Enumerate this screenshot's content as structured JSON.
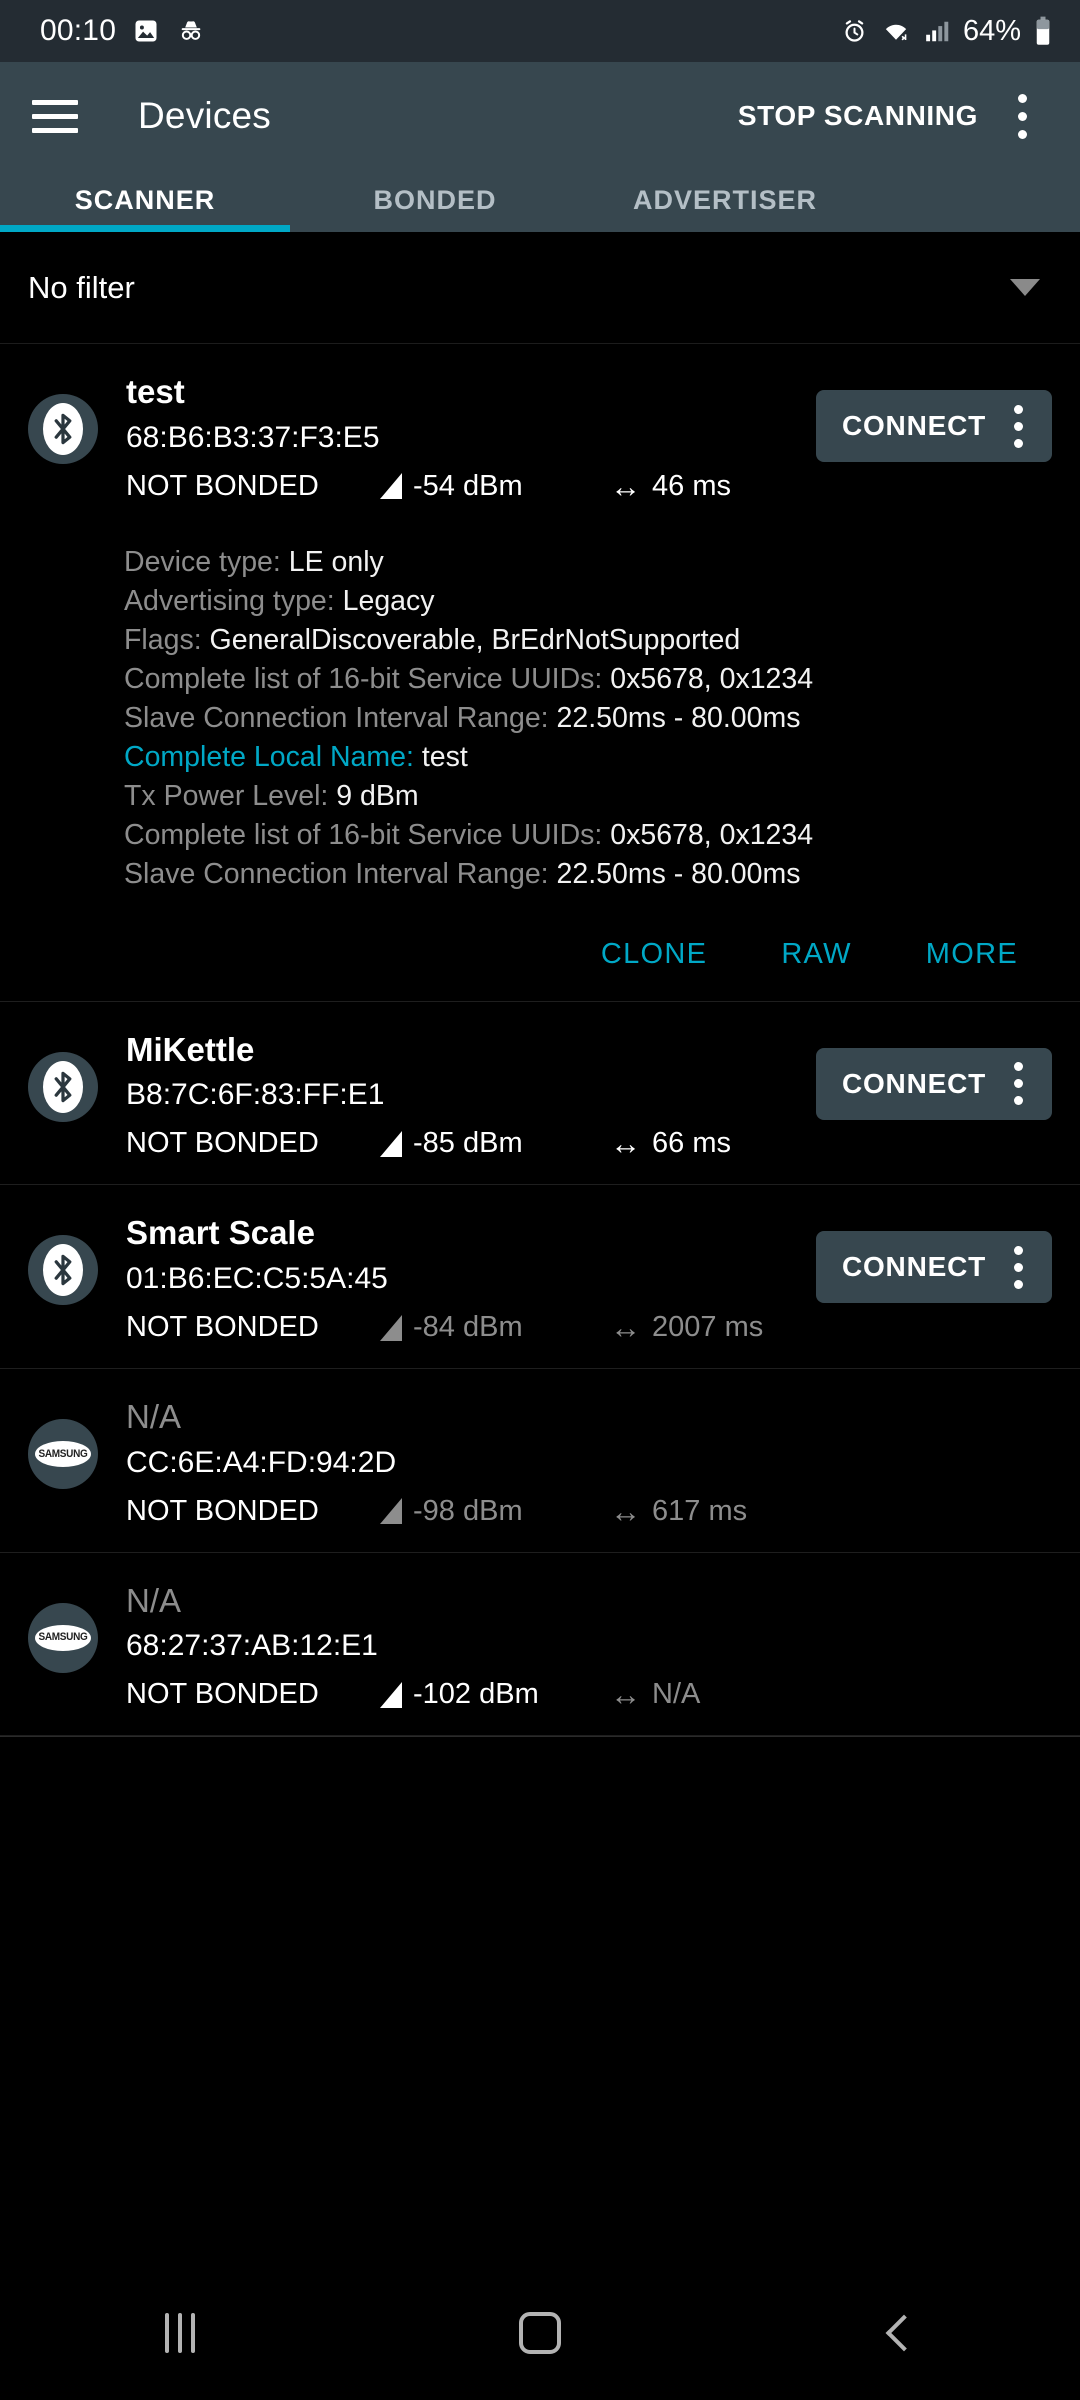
{
  "statusbar": {
    "time": "00:10",
    "battery": "64%",
    "icons": [
      "image-icon",
      "incognito-icon",
      "alarm-icon",
      "wifi-icon",
      "cellular-signal-icon",
      "battery-icon"
    ]
  },
  "appbar": {
    "title": "Devices",
    "action": "STOP SCANNING",
    "menu_icon": "overflow-menu-icon",
    "nav_icon": "hamburger-menu-icon"
  },
  "tabs": [
    {
      "label": "SCANNER",
      "active": true
    },
    {
      "label": "BONDED",
      "active": false
    },
    {
      "label": "ADVERTISER",
      "active": false
    }
  ],
  "filter": {
    "label": "No filter",
    "caret_icon": "chevron-down-icon"
  },
  "colors": {
    "accent": "#00a8c6",
    "appbar": "#37474f",
    "background": "#000000",
    "dim_text": "#8d8d8d"
  },
  "devices": [
    {
      "name": "test",
      "name_dim": false,
      "address": "68:B6:B3:37:F3:E5",
      "bond_state": "NOT BONDED",
      "rssi": "-54 dBm",
      "rssi_dim": false,
      "interval": "46 ms",
      "interval_dim": false,
      "avatar": "bluetooth-icon",
      "connect_label": "CONNECT",
      "has_connect": true,
      "expanded": true,
      "details": [
        {
          "key": "Device type:",
          "value": "LE only",
          "highlight": false
        },
        {
          "key": "Advertising type:",
          "value": "Legacy",
          "highlight": false
        },
        {
          "key": "Flags:",
          "value": "GeneralDiscoverable, BrEdrNotSupported",
          "highlight": false
        },
        {
          "key": "Complete list of 16-bit Service UUIDs:",
          "value": "0x5678, 0x1234",
          "highlight": false
        },
        {
          "key": "Slave Connection Interval Range:",
          "value": "22.50ms - 80.00ms",
          "highlight": false
        },
        {
          "key": "Complete Local Name:",
          "value": "test",
          "highlight": true
        },
        {
          "key": "Tx Power Level:",
          "value": "9 dBm",
          "highlight": false
        },
        {
          "key": "Complete list of 16-bit Service UUIDs:",
          "value": "0x5678, 0x1234",
          "highlight": false
        },
        {
          "key": "Slave Connection Interval Range:",
          "value": "22.50ms - 80.00ms",
          "highlight": false
        }
      ],
      "actions": [
        "CLONE",
        "RAW",
        "MORE"
      ]
    },
    {
      "name": "MiKettle",
      "name_dim": false,
      "address": "B8:7C:6F:83:FF:E1",
      "bond_state": "NOT BONDED",
      "rssi": "-85 dBm",
      "rssi_dim": false,
      "interval": "66 ms",
      "interval_dim": false,
      "avatar": "bluetooth-icon",
      "connect_label": "CONNECT",
      "has_connect": true,
      "expanded": false
    },
    {
      "name": "Smart Scale",
      "name_dim": false,
      "address": "01:B6:EC:C5:5A:45",
      "bond_state": "NOT BONDED",
      "rssi": "-84 dBm",
      "rssi_dim": true,
      "interval": "2007 ms",
      "interval_dim": true,
      "avatar": "bluetooth-icon",
      "connect_label": "CONNECT",
      "has_connect": true,
      "expanded": false
    },
    {
      "name": "N/A",
      "name_dim": true,
      "address": "CC:6E:A4:FD:94:2D",
      "bond_state": "NOT BONDED",
      "rssi": "-98 dBm",
      "rssi_dim": true,
      "interval": "617 ms",
      "interval_dim": true,
      "avatar": "samsung-logo-icon",
      "connect_label": "",
      "has_connect": false,
      "expanded": false
    },
    {
      "name": "N/A",
      "name_dim": true,
      "address": "68:27:37:AB:12:E1",
      "bond_state": "NOT BONDED",
      "rssi": "-102 dBm",
      "rssi_dim": false,
      "interval": "N/A",
      "interval_dim": true,
      "avatar": "samsung-logo-icon",
      "connect_label": "",
      "has_connect": false,
      "expanded": false
    }
  ],
  "navbar": {
    "recents": "recents-icon",
    "home": "home-icon",
    "back": "back-icon"
  },
  "samsung_wordmark": "SAMSUNG"
}
